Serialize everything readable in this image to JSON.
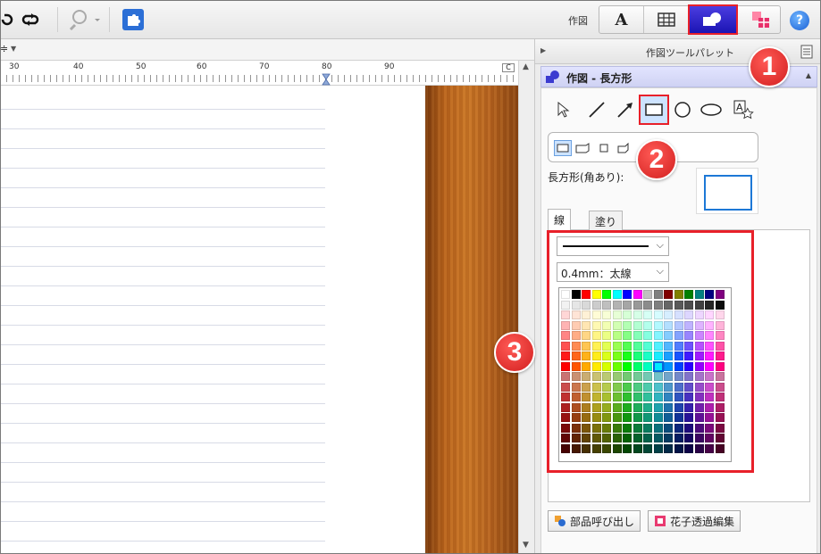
{
  "toolbar": {
    "mode_label": "作図",
    "modes": [
      "text-mode",
      "table-mode",
      "draw-mode",
      "parts-mode"
    ],
    "help": "?"
  },
  "ruler": {
    "left_label": "≑",
    "numbers": [
      "30",
      "40",
      "50",
      "60",
      "70",
      "80",
      "90"
    ],
    "end_label": "C"
  },
  "panel": {
    "title": "作図ツールパレット",
    "sub_title": "作図 - 長方形",
    "shape_label": "長方形(角あり):",
    "tabs": [
      "線",
      "塗り"
    ],
    "line_style": "",
    "line_width": "0.4mm：太線",
    "buttons": {
      "parts": "部品呼び出し",
      "transparent": "花子透過編集"
    }
  },
  "callouts": [
    "1",
    "2",
    "3"
  ],
  "palette": {
    "selected_row": 7,
    "selected_col": 9
  }
}
